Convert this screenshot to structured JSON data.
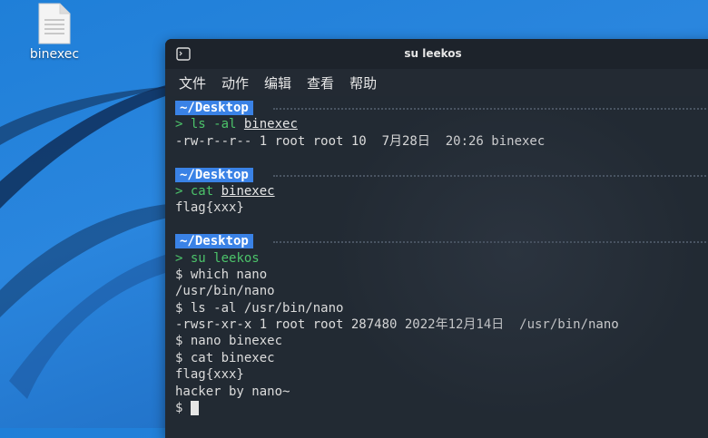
{
  "desktop": {
    "file_label": "binexec"
  },
  "window": {
    "title": "su leekos"
  },
  "menu": [
    "文件",
    "动作",
    "编辑",
    "查看",
    "帮助"
  ],
  "prompt_path": "~/Desktop",
  "lines": [
    {
      "t": "path"
    },
    {
      "t": "cmd",
      "cmd": "ls -al",
      "arg": "binexec"
    },
    {
      "t": "out",
      "text": "-rw-r--r-- 1 root root 10  7月28日  20:26 binexec"
    },
    {
      "t": "blank"
    },
    {
      "t": "path"
    },
    {
      "t": "cmd",
      "cmd": "cat",
      "arg": "binexec"
    },
    {
      "t": "out",
      "text": "flag{xxx}"
    },
    {
      "t": "blank"
    },
    {
      "t": "path"
    },
    {
      "t": "cmd",
      "cmd": "su",
      "arg": "leekos",
      "plain": true
    },
    {
      "t": "out",
      "text": "$ which nano"
    },
    {
      "t": "out",
      "text": "/usr/bin/nano"
    },
    {
      "t": "out",
      "text": "$ ls -al /usr/bin/nano"
    },
    {
      "t": "out",
      "text": "-rwsr-xr-x 1 root root 287480 2022年12月14日  /usr/bin/nano"
    },
    {
      "t": "out",
      "text": "$ nano binexec"
    },
    {
      "t": "out",
      "text": "$ cat binexec"
    },
    {
      "t": "out",
      "text": "flag{xxx}"
    },
    {
      "t": "out",
      "text": "hacker by nano~"
    },
    {
      "t": "input",
      "prompt": "$ "
    }
  ],
  "icons": {
    "file": "file-icon",
    "terminal": "terminal-icon"
  }
}
